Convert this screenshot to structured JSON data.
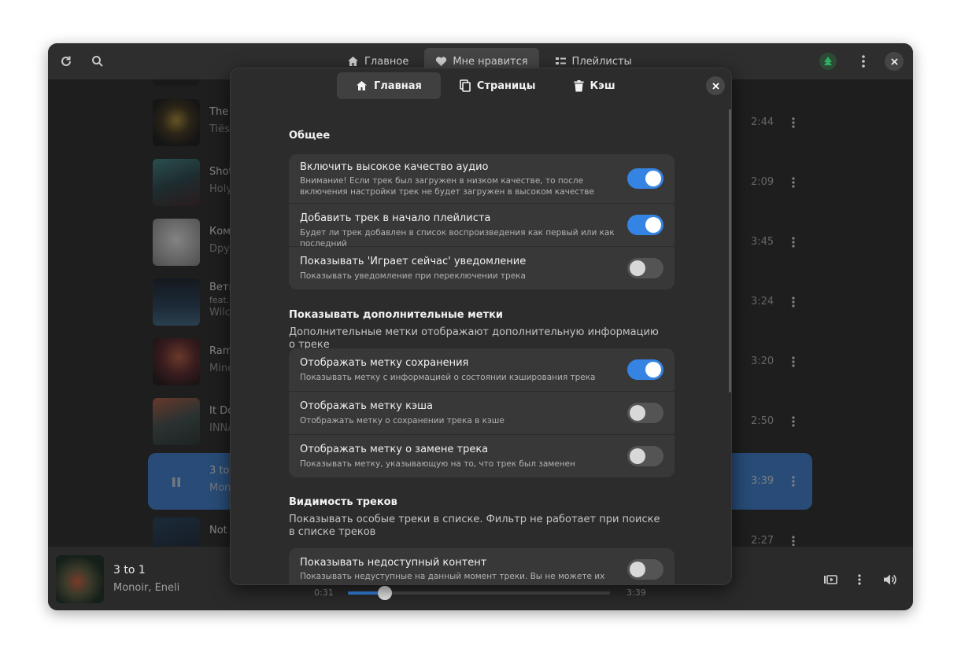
{
  "header": {
    "tabs": [
      {
        "label": "Главное",
        "icon": "home-icon"
      },
      {
        "label": "Мне нравится",
        "icon": "heart-icon"
      },
      {
        "label": "Плейлисты",
        "icon": "playlists-icon"
      }
    ],
    "active_tab": "Мне нравится"
  },
  "tracks": [
    {
      "title": "The",
      "artist": "Tiëst",
      "duration": "2:44"
    },
    {
      "title": "Shot",
      "artist": "Holy",
      "duration": "2:09"
    },
    {
      "title": "Ком",
      "artist": "Dpyн",
      "duration": "3:45"
    },
    {
      "title": "Вети",
      "feat": "feat.",
      "artist": "Wilc",
      "duration": "3:24"
    },
    {
      "title": "Ram",
      "artist": "Mine",
      "duration": "3:20"
    },
    {
      "title": "It Do",
      "artist": "INNA",
      "duration": "2:50"
    },
    {
      "title": "3 to",
      "artist": "Mon",
      "duration": "3:39"
    },
    {
      "title": "Not",
      "artist": "",
      "duration": "2:27"
    }
  ],
  "player": {
    "title": "3 to 1",
    "artist": "Monoir, Eneli",
    "time_current": "0:31",
    "time_total": "3:39",
    "progress": 0.14
  },
  "dialog": {
    "tabs": [
      {
        "label": "Главная",
        "icon": "home-icon"
      },
      {
        "label": "Страницы",
        "icon": "pages-icon"
      },
      {
        "label": "Кэш",
        "icon": "trash-icon"
      }
    ],
    "active_tab": "Главная",
    "groups": {
      "general": {
        "title": "Общее",
        "rows": [
          {
            "title": "Включить высокое качество аудио",
            "subtitle": "Внимание! Если трек был загружен в низком качестве, то после включения настройки трек не будет загружен в высоком качестве",
            "enabled": true
          },
          {
            "title": "Добавить трек в начало плейлиста",
            "subtitle": "Будет ли трек добавлен в список воспроизведения как первый или как последний",
            "enabled": true
          },
          {
            "title": "Показывать 'Играет сейчас' уведомление",
            "subtitle": "Показывать уведомление при переключении трека",
            "enabled": false
          }
        ]
      },
      "labels": {
        "title": "Показывать дополнительные метки",
        "description": "Дополнительные метки отображают дополнительную информацию о треке",
        "rows": [
          {
            "title": "Отображать метку сохранения",
            "subtitle": "Показывать метку с информацией о состоянии кэширования трека",
            "enabled": true
          },
          {
            "title": "Отображать метку кэша",
            "subtitle": "Отображать метку о сохранении трека в кэше",
            "enabled": false
          },
          {
            "title": "Отображать метку о замене трека",
            "subtitle": "Показывать метку, указывающую на то, что трек был заменен",
            "enabled": false
          }
        ]
      },
      "visibility": {
        "title": "Видимость треков",
        "description": "Показывать особые треки в списке. Фильтр не работает при поиске в списке треков",
        "rows": [
          {
            "title": "Показывать недоступный контент",
            "subtitle": "Показывать недуступные на данный момент треки. Вы не можете их прослушать",
            "enabled": false
          }
        ]
      }
    }
  },
  "colors": {
    "accent": "#3584e4",
    "window_bg": "#1e1e1e",
    "dialog_bg": "#2c2c2c",
    "row_bg": "#383838"
  }
}
